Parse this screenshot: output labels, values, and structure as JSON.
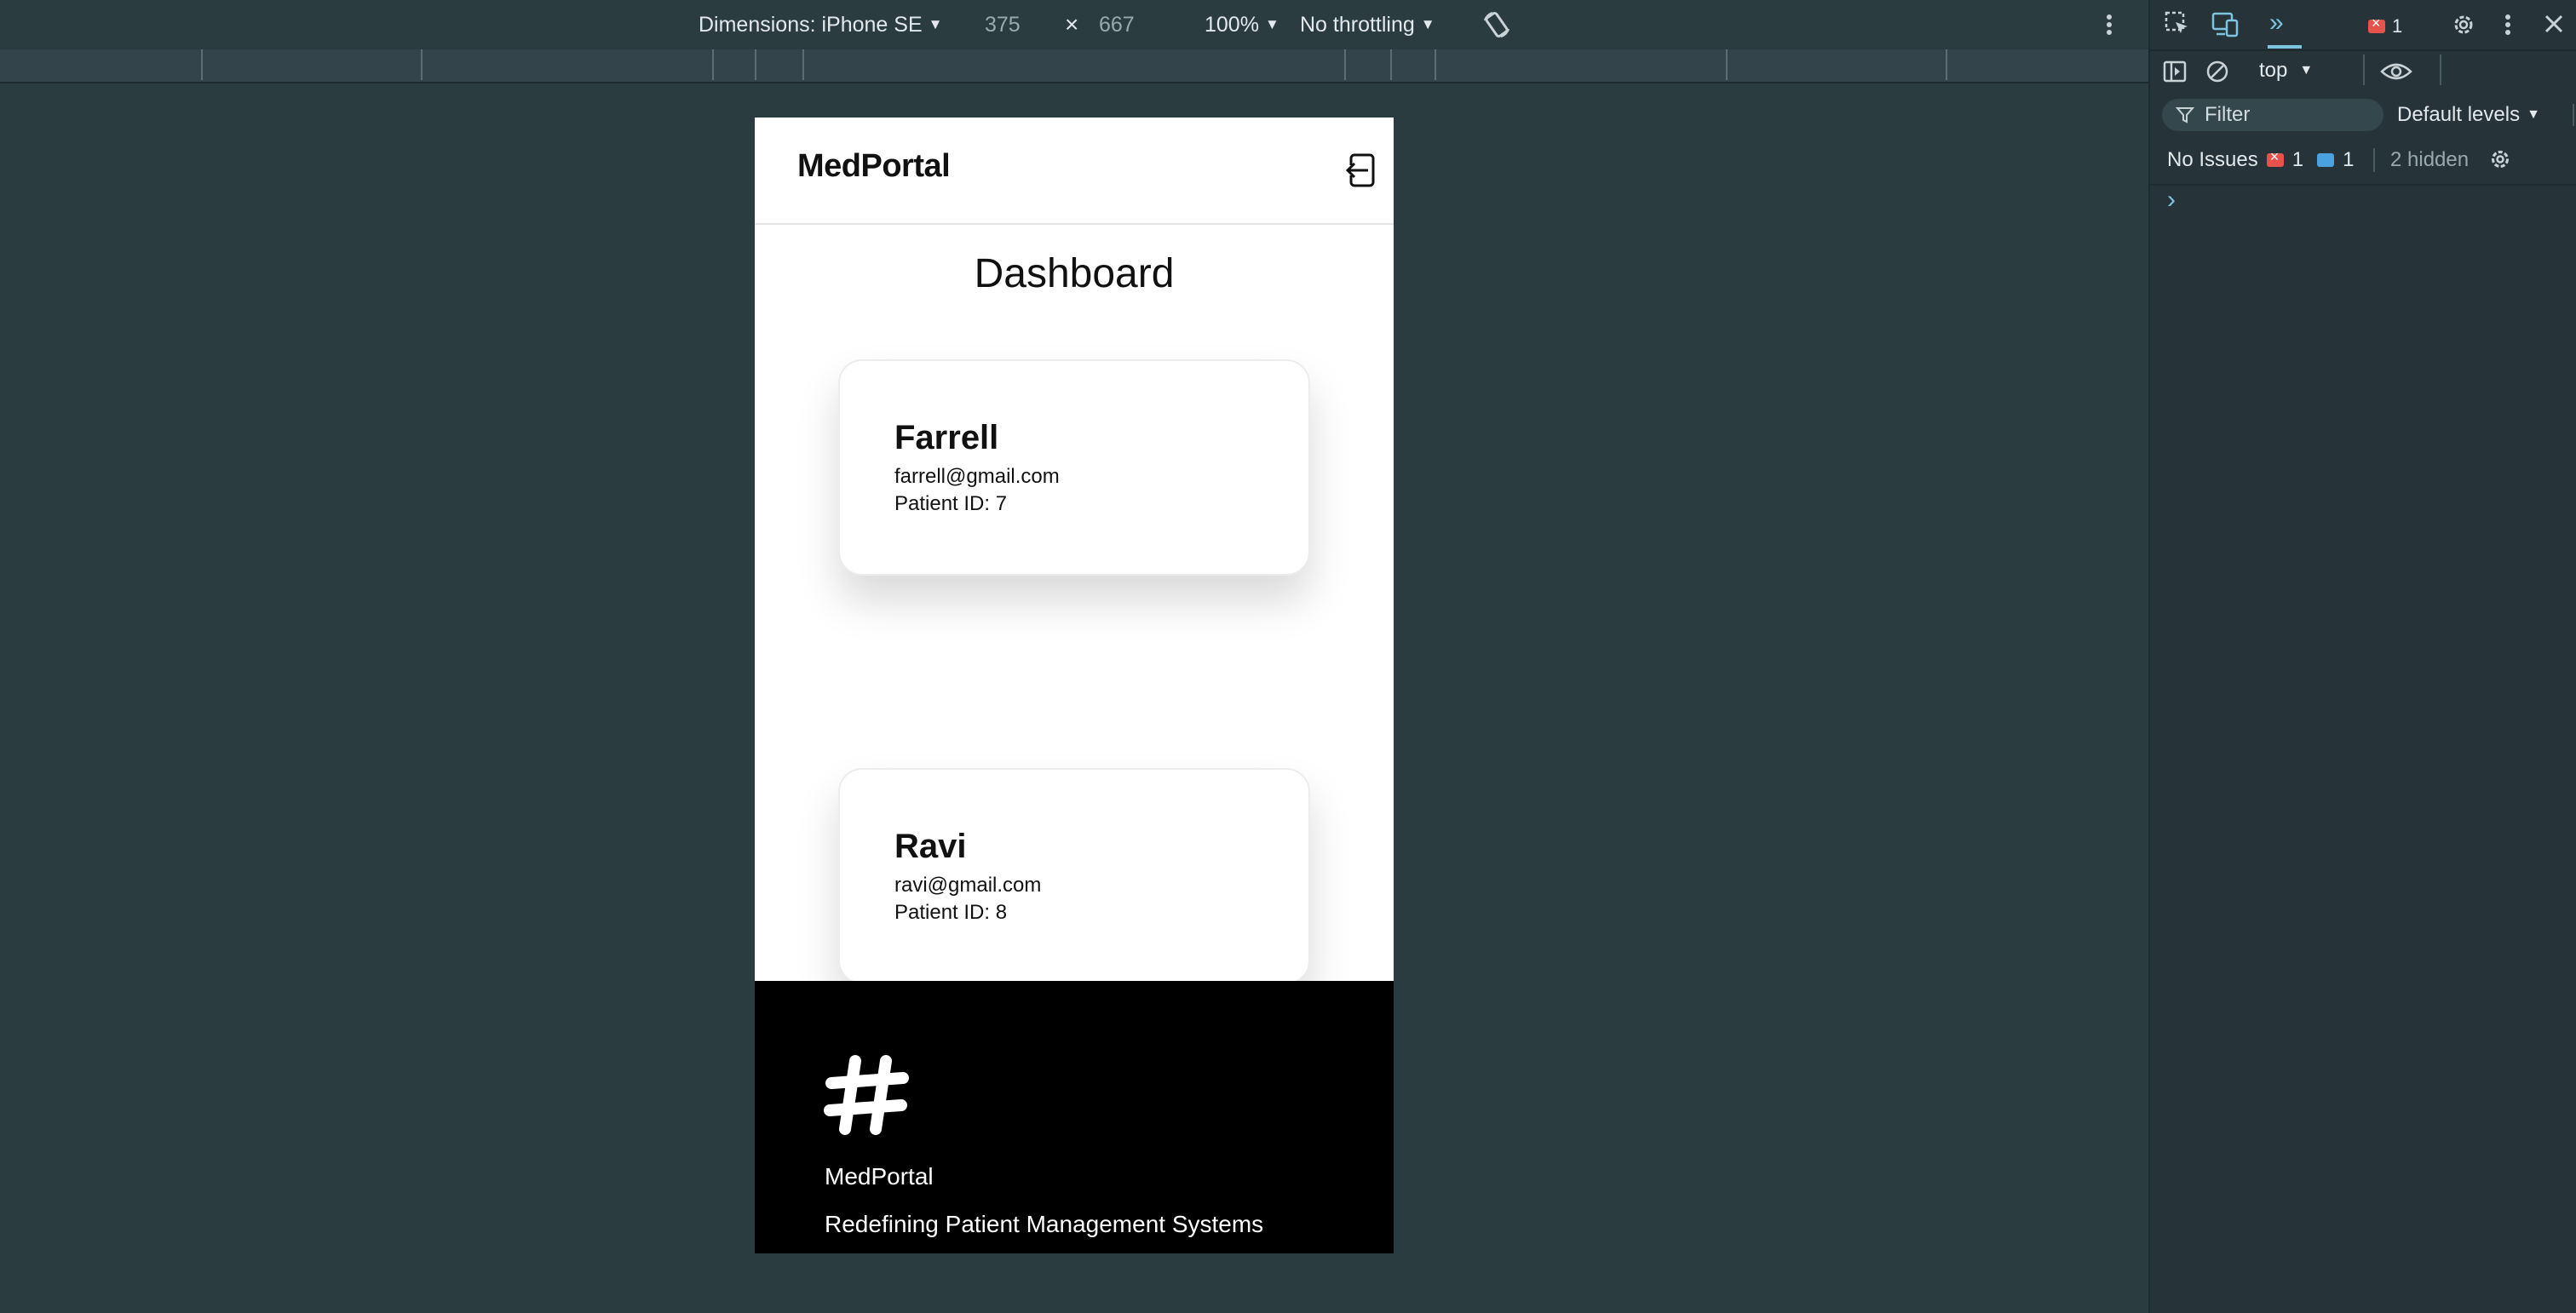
{
  "device_toolbar": {
    "dimensions_label": "Dimensions: iPhone SE",
    "width": "375",
    "height": "667",
    "times": "×",
    "zoom": "100%",
    "throttling": "No throttling"
  },
  "devtools": {
    "error_count": "1",
    "context": "top",
    "filter_placeholder": "Filter",
    "levels": "Default levels",
    "issues_label": "No Issues",
    "issue_errors": "1",
    "issue_messages": "1",
    "hidden": "2 hidden",
    "prompt": "›"
  },
  "app": {
    "brand": "MedPortal",
    "page_title": "Dashboard",
    "patients": [
      {
        "name": "Farrell",
        "email": "farrell@gmail.com",
        "id_label": "Patient ID: 7"
      },
      {
        "name": "Ravi",
        "email": "ravi@gmail.com",
        "id_label": "Patient ID: 8"
      }
    ],
    "footer": {
      "brand": "MedPortal",
      "tagline": "Redefining Patient Management Systems"
    }
  },
  "colors": {
    "workspace_bg": "#2b3c41",
    "devtools_bg": "#263338",
    "accent": "#7cc4e0",
    "error": "#e5534b",
    "footer_bg": "#000000"
  }
}
